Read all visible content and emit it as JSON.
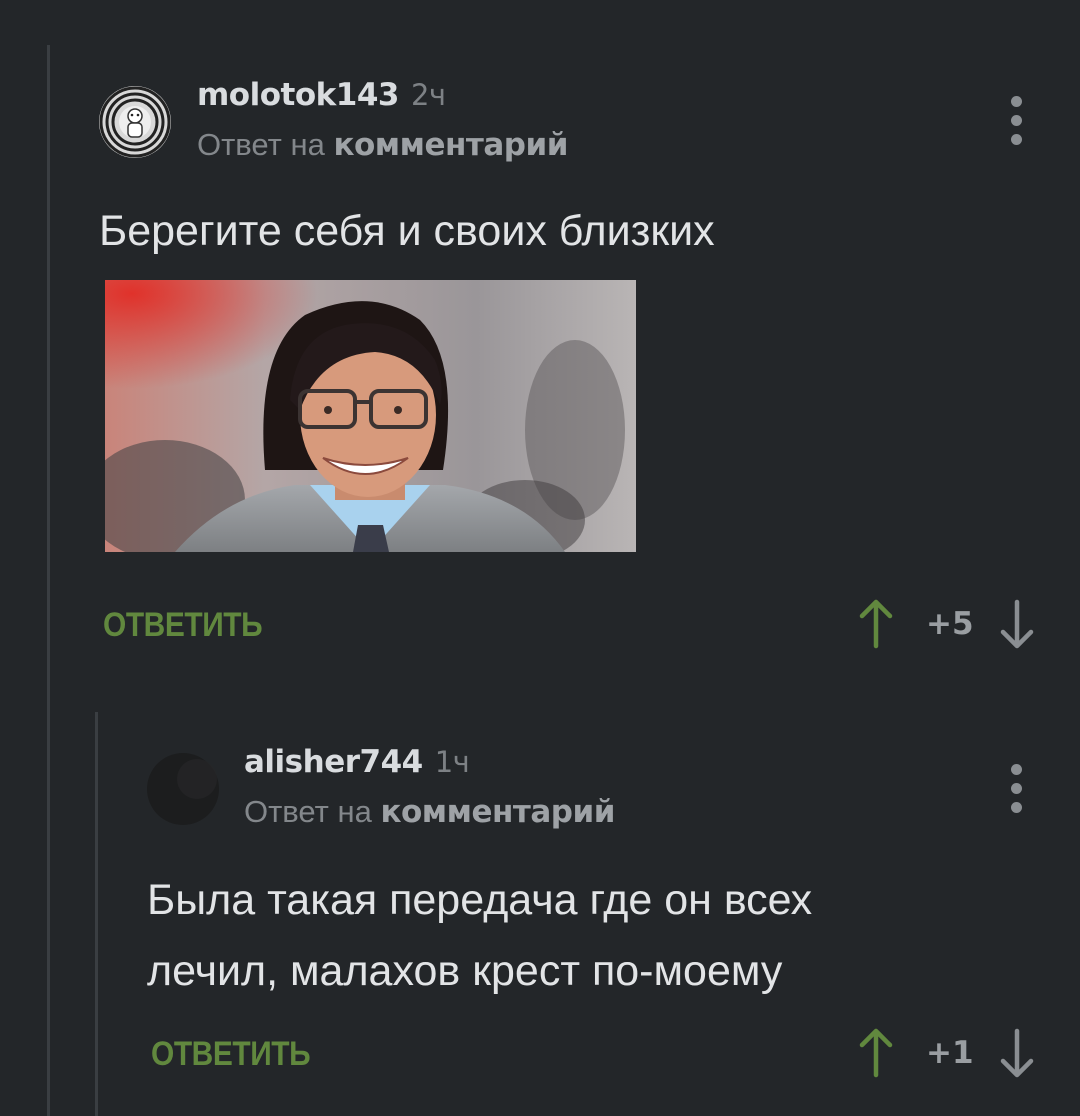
{
  "comments": [
    {
      "username": "molotok143",
      "time": "2ч",
      "reply_prefix": "Ответ на",
      "reply_target": "комментарий",
      "text": "Берегите себя и своих близких",
      "reply_label": "ОТВЕТИТЬ",
      "score": "+5"
    },
    {
      "username": "alisher744",
      "time": "1ч",
      "reply_prefix": "Ответ на",
      "reply_target": "комментарий",
      "text": "Была такая передача где он всех лечил, малахов крест по-моему",
      "reply_label": "ОТВЕТИТЬ",
      "score": "+1"
    }
  ],
  "colors": {
    "background": "#232629",
    "upvote": "#61883e",
    "downvote": "#8a8e92"
  },
  "icons": [
    "more-vertical-icon",
    "arrow-up-icon",
    "arrow-down-icon"
  ]
}
